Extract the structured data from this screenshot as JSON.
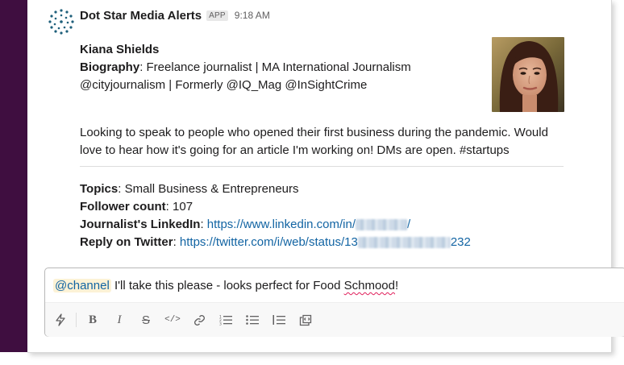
{
  "message": {
    "sender": "Dot Star Media Alerts",
    "badge": "APP",
    "time": "9:18 AM",
    "name": "Kiana Shields",
    "bio_label": "Biography",
    "bio_line1": ": Freelance journalist | MA International Journalism",
    "bio_line2": "@cityjournalism | Formerly @IQ_Mag @InSightCrime",
    "request_line1": "Looking to speak to people who opened their first business during the pandemic. Would",
    "request_line2": "love to hear how it's going for an article I'm working on! DMs are open. #startups",
    "topics_label": "Topics",
    "topics_value": ": Small Business & Entrepreneurs",
    "followers_label": "Follower count",
    "followers_value": ": 107",
    "linkedin_label": "Journalist's LinkedIn",
    "linkedin_sep": ": ",
    "linkedin_url_prefix": "https://www.linkedin.com/in/",
    "linkedin_url_suffix": "/",
    "twitter_label": "Reply on Twitter",
    "twitter_sep": ": ",
    "twitter_url_prefix": "https://twitter.com/i/web/status/13",
    "twitter_url_suffix": "232"
  },
  "composer": {
    "mention": "@channel",
    "text_before": " I'll take this please - looks perfect for Food ",
    "misspelled_word": "Schmood",
    "text_after": "!"
  },
  "toolbar": {
    "bold": "B",
    "italic": "I",
    "strike": "S",
    "code": "</>"
  },
  "colors": {
    "sidebar": "#3f0e40",
    "link": "#1264a3",
    "mention_bg": "#fcf2d6"
  }
}
